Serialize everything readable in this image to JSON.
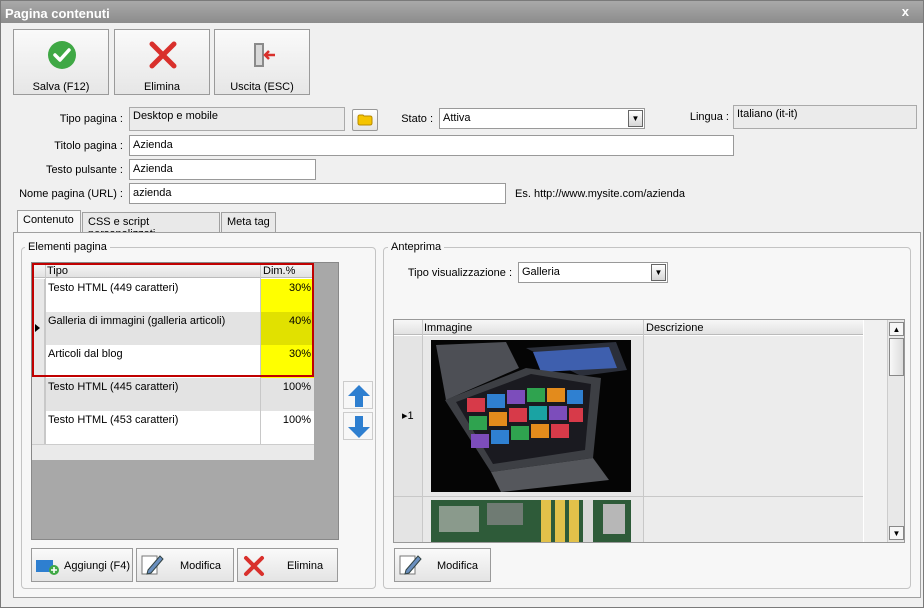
{
  "window": {
    "title": "Pagina contenuti",
    "close": "x"
  },
  "toolbar": {
    "save_label": "Salva (F12)",
    "delete_label": "Elimina",
    "exit_label": "Uscita (ESC)"
  },
  "form": {
    "tipo_pagina_label": "Tipo pagina :",
    "tipo_pagina_value": "Desktop e mobile",
    "stato_label": "Stato :",
    "stato_value": "Attiva",
    "lingua_label": "Lingua :",
    "lingua_value": "Italiano (it-it)",
    "titolo_label": "Titolo pagina :",
    "titolo_value": "Azienda",
    "testo_pulsante_label": "Testo pulsante :",
    "testo_pulsante_value": "Azienda",
    "nome_pagina_label": "Nome pagina (URL) :",
    "nome_pagina_value": "azienda",
    "url_example": "Es. http://www.mysite.com/azienda"
  },
  "tabs": [
    {
      "label": "Contenuto"
    },
    {
      "label": "CSS e script personalizzati"
    },
    {
      "label": "Meta tag"
    }
  ],
  "elements": {
    "title": "Elementi pagina",
    "columns": {
      "tipo": "Tipo",
      "dim": "Dim.%"
    },
    "rows": [
      {
        "tipo": "Testo HTML (449 caratteri)",
        "dim": "30%",
        "highlight": true
      },
      {
        "tipo": "Galleria di immagini (galleria articoli)",
        "dim": "40%",
        "highlight": true,
        "current": true
      },
      {
        "tipo": "Articoli dal blog",
        "dim": "30%",
        "highlight": true
      },
      {
        "tipo": "Testo HTML (445 caratteri)",
        "dim": "100%",
        "highlight": false
      },
      {
        "tipo": "Testo HTML (453 caratteri)",
        "dim": "100%",
        "highlight": false
      }
    ],
    "add_label": "Aggiungi (F4)",
    "edit_label": "Modifica",
    "delete_label": "Elimina"
  },
  "preview": {
    "title": "Anteprima",
    "view_label": "Tipo visualizzazione :",
    "view_value": "Galleria",
    "columns": {
      "immagine": "Immagine",
      "descrizione": "Descrizione"
    },
    "rows": [
      {
        "num": "1"
      }
    ],
    "edit_label": "Modifica"
  },
  "colors": {
    "highlight_yellow": "#ffff00",
    "selection_red": "#c00000",
    "arrow_blue": "#2e7fd0",
    "save_green": "#3fa845",
    "delete_red": "#d9302c"
  }
}
